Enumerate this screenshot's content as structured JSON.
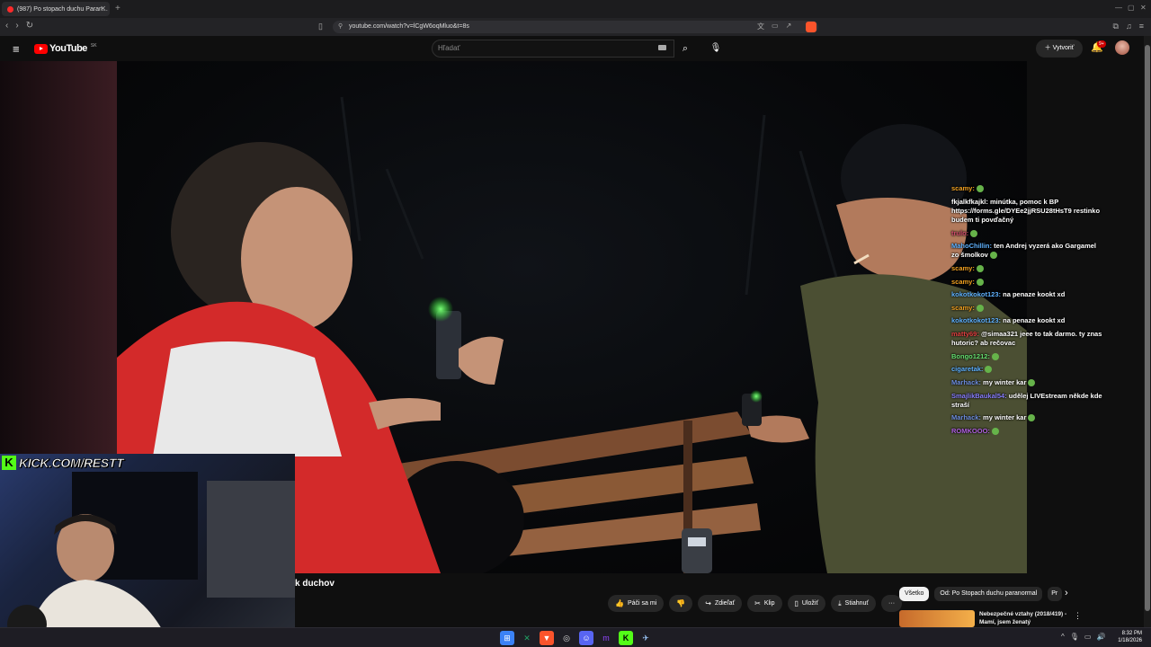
{
  "browser": {
    "tab_title": "(987) Po stopach duchu Paran...",
    "new_tab": "+",
    "url": "youtube.com/watch?v=lCgW6oqMluo&t=8s"
  },
  "youtube": {
    "logo_text": "YouTube",
    "country": "SK",
    "search_placeholder": "Hľadať",
    "create_label": "Vytvoriť",
    "notifications": "9+"
  },
  "video": {
    "title_fragment": "k duchov"
  },
  "stream_overlay": {
    "kick_url": "KICK.COM/RESTT"
  },
  "chat": [
    {
      "user": "scamy:",
      "text": "",
      "color": "#f0a020",
      "emote": true
    },
    {
      "user": "fkjalkfkajkl:",
      "text": "minútka, pomoc k BP https://forms.gle/DYEe2jjRSU28tHsT9 restinko budem ti povďačný",
      "color": "#ffffff",
      "emote": false
    },
    {
      "user": "trulo:",
      "text": "",
      "color": "#d04a6a",
      "emote": true
    },
    {
      "user": "MahoChillin:",
      "text": "ten Andrej vyzerá ako Gargamel zo šmolkov",
      "color": "#5fb2ff",
      "emote": true
    },
    {
      "user": "scamy:",
      "text": "",
      "color": "#f0a020",
      "emote": true
    },
    {
      "user": "scamy:",
      "text": "",
      "color": "#f0a020",
      "emote": true
    },
    {
      "user": "kokotkokot123:",
      "text": "na penaze kookt xd",
      "color": "#5fb2ff",
      "emote": false
    },
    {
      "user": "scamy:",
      "text": "",
      "color": "#f0a020",
      "emote": true
    },
    {
      "user": "kokotkokot123:",
      "text": "na penaze kookt xd",
      "color": "#5fb2ff",
      "emote": false
    },
    {
      "user": "matty69:",
      "text": "@simaa321 jeee to tak darmo. ty znas hutoric? ab rečovac",
      "color": "#e04040",
      "emote": false
    },
    {
      "user": "Bongo1212:",
      "text": "",
      "color": "#66e070",
      "emote": true
    },
    {
      "user": "cigaretak:",
      "text": "",
      "color": "#5fb2ff",
      "emote": true
    },
    {
      "user": "Marhack:",
      "text": "my winter kar",
      "color": "#6f8fe0",
      "emote": true
    },
    {
      "user": "SmajlikBaukal54:",
      "text": "udělej LIVEstream někde kde straší",
      "color": "#8a80ff",
      "emote": false
    },
    {
      "user": "Marhack:",
      "text": "my winter kar",
      "color": "#6f8fe0",
      "emote": true
    },
    {
      "user": "ROMKOOO:",
      "text": "",
      "color": "#b060e0",
      "emote": true
    }
  ],
  "actions": {
    "like": "Páči sa mi",
    "share": "Zdieľať",
    "clip": "Klip",
    "save": "Uložiť",
    "download": "Stiahnuť",
    "more": "···"
  },
  "chips": {
    "all": "Všetko",
    "from": "Od: Po Stopach duchu paranormal",
    "partial": "Pr"
  },
  "recommendation": {
    "title": "Nebezpečné vztahy (2018/419) - Mamí, jsem ženatý"
  },
  "taskbar": {
    "time": "8:32 PM",
    "date": "1/18/2026"
  },
  "colors": {
    "accent": "#ff0000",
    "kick": "#53fc18"
  }
}
